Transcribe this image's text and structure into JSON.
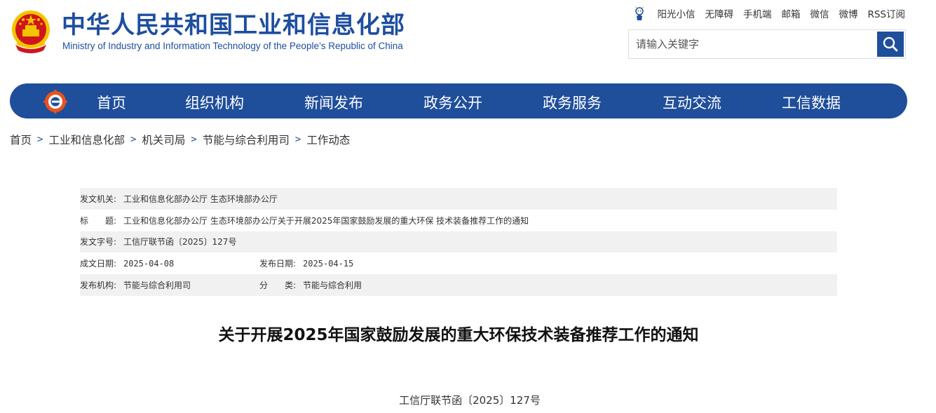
{
  "header": {
    "title_cn": "中华人民共和国工业和信息化部",
    "title_en": "Ministry of Industry and Information Technology of the People’s Republic of China",
    "top_links": [
      "阳光小信",
      "无障碍",
      "手机端",
      "邮箱",
      "微信",
      "微博",
      "RSS订阅"
    ],
    "search_placeholder": "请输入关键字"
  },
  "nav": {
    "items": [
      "首页",
      "组织机构",
      "新闻发布",
      "政务公开",
      "政务服务",
      "互动交流",
      "工信数据"
    ]
  },
  "breadcrumb": [
    "首页",
    "工业和信息化部",
    "机关司局",
    "节能与综合利用司",
    "工作动态"
  ],
  "meta": {
    "issuer_label": "发文机关:",
    "issuer": "工业和信息化部办公厅 生态环境部办公厅",
    "title_label": "标　　题:",
    "title": "工业和信息化部办公厅 生态环境部办公厅关于开展2025年国家鼓励发展的重大环保 技术装备推荐工作的通知",
    "doc_no_label": "发文字号:",
    "doc_no": "工信厅联节函〔2025〕127号",
    "date_label": "成文日期:",
    "date": "2025-04-08",
    "pub_date_label": "发布日期:",
    "pub_date": "2025-04-15",
    "org_label": "发布机构:",
    "org": "节能与综合利用司",
    "cat_label": "分　　类:",
    "cat": "节能与综合利用"
  },
  "document": {
    "title": "关于开展2025年国家鼓励发展的重大环保技术装备推荐工作的通知",
    "number": "工信厅联节函〔2025〕127号"
  },
  "colors": {
    "brand_blue": "#1f4e9b",
    "title_blue": "#1d4ea0",
    "emblem_red": "#d0161b",
    "emblem_gold": "#f5c400"
  }
}
